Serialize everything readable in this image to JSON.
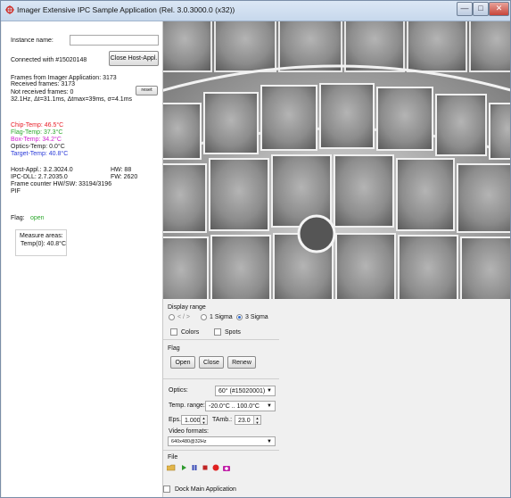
{
  "window": {
    "title": "Imager Extensive IPC Sample Application (Rel. 3.0.3000.0 (x32))",
    "controls": {
      "minimize": "—",
      "maximize": "□",
      "close": "✕"
    }
  },
  "left": {
    "instance_label": "Instance name:",
    "instance_value": "",
    "connected_text": "Connected with #15020148",
    "close_host_button": "Close Host-Appl.",
    "frames_from": "Frames from Imager Application: 3173",
    "received_frames": "Received frames: 3173",
    "not_received_frames": "Not received frames: 0",
    "reset_button": "reset",
    "timing": "32.1Hz,  Δt=31.1ms, Δtmax=39ms, σ=4.1ms",
    "chip_temp": "Chip-Temp: 46.5°C",
    "flag_temp": "Flag-Temp: 37.3°C",
    "box_temp": "Box-Temp: 34.2°C",
    "optics_temp": "Optics-Temp: 0.0°C",
    "target_temp": "Target-Temp: 40.8°C",
    "host_appl": "Host-Appl.: 3.2.3024.0",
    "hw": "HW: 88",
    "ipc_dll": "IPC-DLL: 2.7.2035.0",
    "fw": "FW: 2620",
    "frame_counter": "Frame counter HW/SW: 33194/3196",
    "pif": "PIF",
    "flag_label": "Flag:",
    "flag_state": "open",
    "measure_areas_label": "Measure areas:",
    "measure_temp": "Temp(0): 40.8°C"
  },
  "panel": {
    "display_range_label": "Display range",
    "radio_minmax": "< / >",
    "radio_1sigma": "1 Sigma",
    "radio_3sigma": "3 Sigma",
    "selected_range": "3 Sigma",
    "colors_label": "Colors",
    "spots_label": "Spots",
    "flag_section": "Flag",
    "open_button": "Open",
    "close_button": "Close",
    "renew_button": "Renew",
    "optics_label": "Optics:",
    "optics_value": "60° (#15020001)",
    "temp_range_label": "Temp. range:",
    "temp_range_value": "-20.0°C .. 100.0°C",
    "eps_label": "Eps.:",
    "eps_value": "1.000",
    "tamb_label": "TAmb.:",
    "tamb_value": "23.0",
    "video_formats_label": "Video formats:",
    "video_format_value": "640x480@32Hz",
    "file_label": "File",
    "dock_label": "Dock Main Application"
  },
  "colors": {
    "chip": "#e8202a",
    "flag": "#2ea82e",
    "box": "#d020d0",
    "optics": "#222222",
    "target": "#2a3ad8",
    "flag_state": "#2ea82e"
  },
  "icons": [
    "folder-open-icon",
    "play-icon",
    "pause-icon",
    "stop-icon",
    "record-icon",
    "camera-icon"
  ]
}
